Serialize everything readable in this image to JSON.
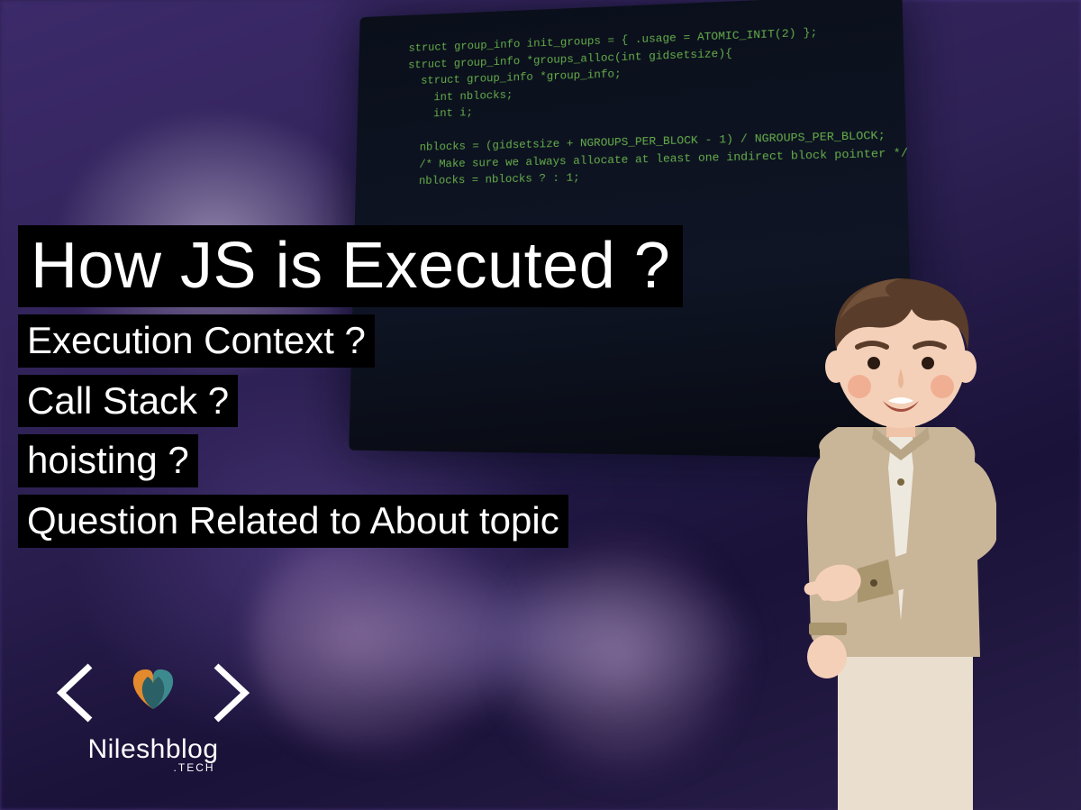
{
  "heading": "How JS is Executed ?",
  "subtitles": [
    "Execution Context ?",
    "Call Stack ?",
    "hoisting ?",
    "Question Related to  About topic"
  ],
  "code_lines": [
    "struct group_info init_groups = { .usage = ATOMIC_INIT(2) };",
    "struct group_info *groups_alloc(int gidsetsize){",
    "  struct group_info *group_info;",
    "    int nblocks;",
    "    int i;",
    "",
    "  nblocks = (gidsetsize + NGROUPS_PER_BLOCK - 1) / NGROUPS_PER_BLOCK;",
    "  /* Make sure we always allocate at least one indirect block pointer */",
    "  nblocks = nblocks ? : 1;"
  ],
  "brand": {
    "name": "Nileshblog",
    "suffix": ".TECH"
  },
  "colors": {
    "text_bg": "#000000",
    "text_fg": "#ffffff",
    "code_fg": "#6fbf4f",
    "heart_orange": "#e38a2e",
    "heart_teal": "#3c8a8e",
    "character_shirt": "#c9b598",
    "character_hair": "#5a3c2a",
    "character_skin": "#f5d0b8"
  }
}
